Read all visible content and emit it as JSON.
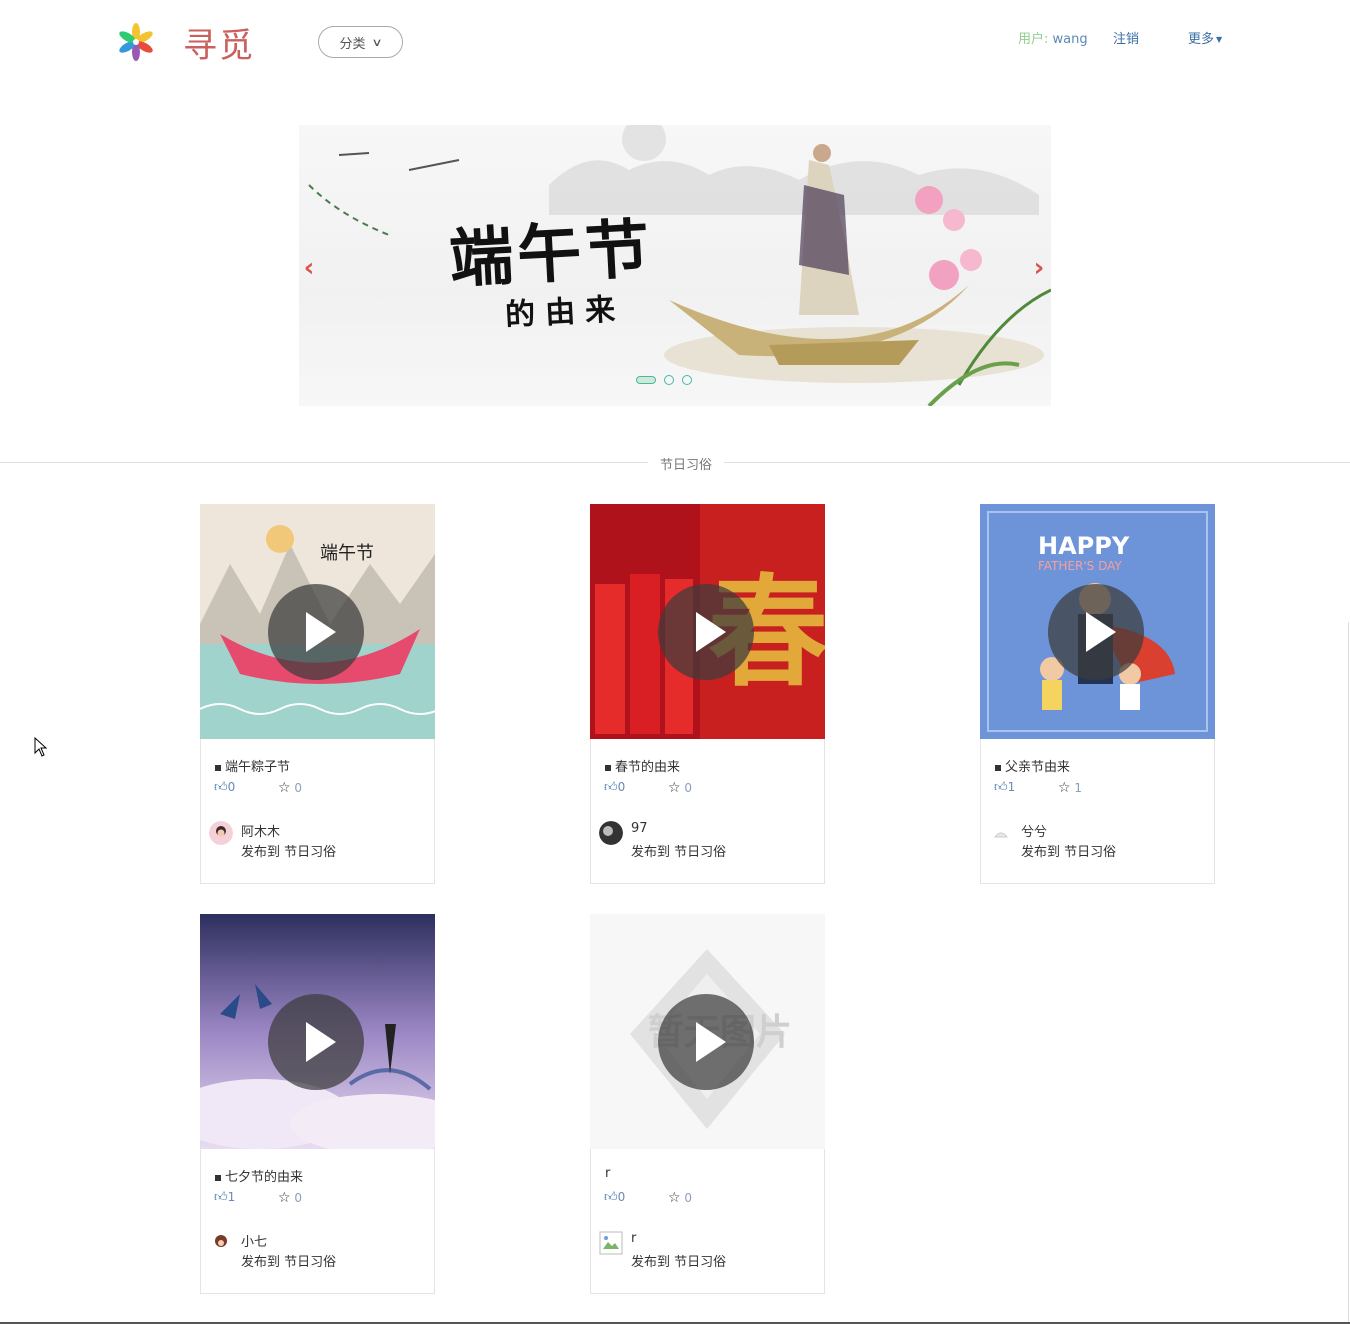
{
  "header": {
    "site_title": "寻觅",
    "category_label": "分类",
    "user_prefix": "用户:",
    "username": "wang",
    "logout_label": "注销",
    "more_label": "更多"
  },
  "banner": {
    "title_main": "端午节",
    "title_sub": "的由来",
    "slide_count": 3,
    "active_slide": 1
  },
  "section": {
    "title": "节日习俗"
  },
  "cards": [
    {
      "title": "端午粽子节",
      "likes": "0",
      "favs": "0",
      "author": "阿木木",
      "posted_prefix": "发布到",
      "category": "节日习俗",
      "thumb_text": "端午节"
    },
    {
      "title": "春节的由来",
      "likes": "0",
      "favs": "0",
      "author": "97",
      "posted_prefix": "发布到",
      "category": "节日习俗",
      "thumb_text": "春"
    },
    {
      "title": "父亲节由来",
      "likes": "1",
      "favs": "1",
      "author": "兮兮",
      "posted_prefix": "发布到",
      "category": "节日习俗",
      "thumb_text": "HAPPY",
      "thumb_subtext": "FATHER'S DAY"
    },
    {
      "title": "七夕节的由来",
      "likes": "1",
      "favs": "0",
      "author": "小七",
      "posted_prefix": "发布到",
      "category": "节日习俗"
    },
    {
      "title": "r",
      "likes": "0",
      "favs": "0",
      "author": "r",
      "posted_prefix": "发布到",
      "category": "节日习俗",
      "thumb_text": "暂无图片"
    }
  ],
  "colors": {
    "brand": "#c9605b",
    "link": "#3a6fa5",
    "user_label": "#8fce8f",
    "carousel_arrow": "#d9534f"
  },
  "icons": [
    "flower-logo-icon",
    "chevron-down-icon",
    "caret-down-icon",
    "chevron-left-icon",
    "chevron-right-icon",
    "play-icon",
    "thumbs-up-icon",
    "star-icon",
    "mouse-cursor-icon"
  ]
}
